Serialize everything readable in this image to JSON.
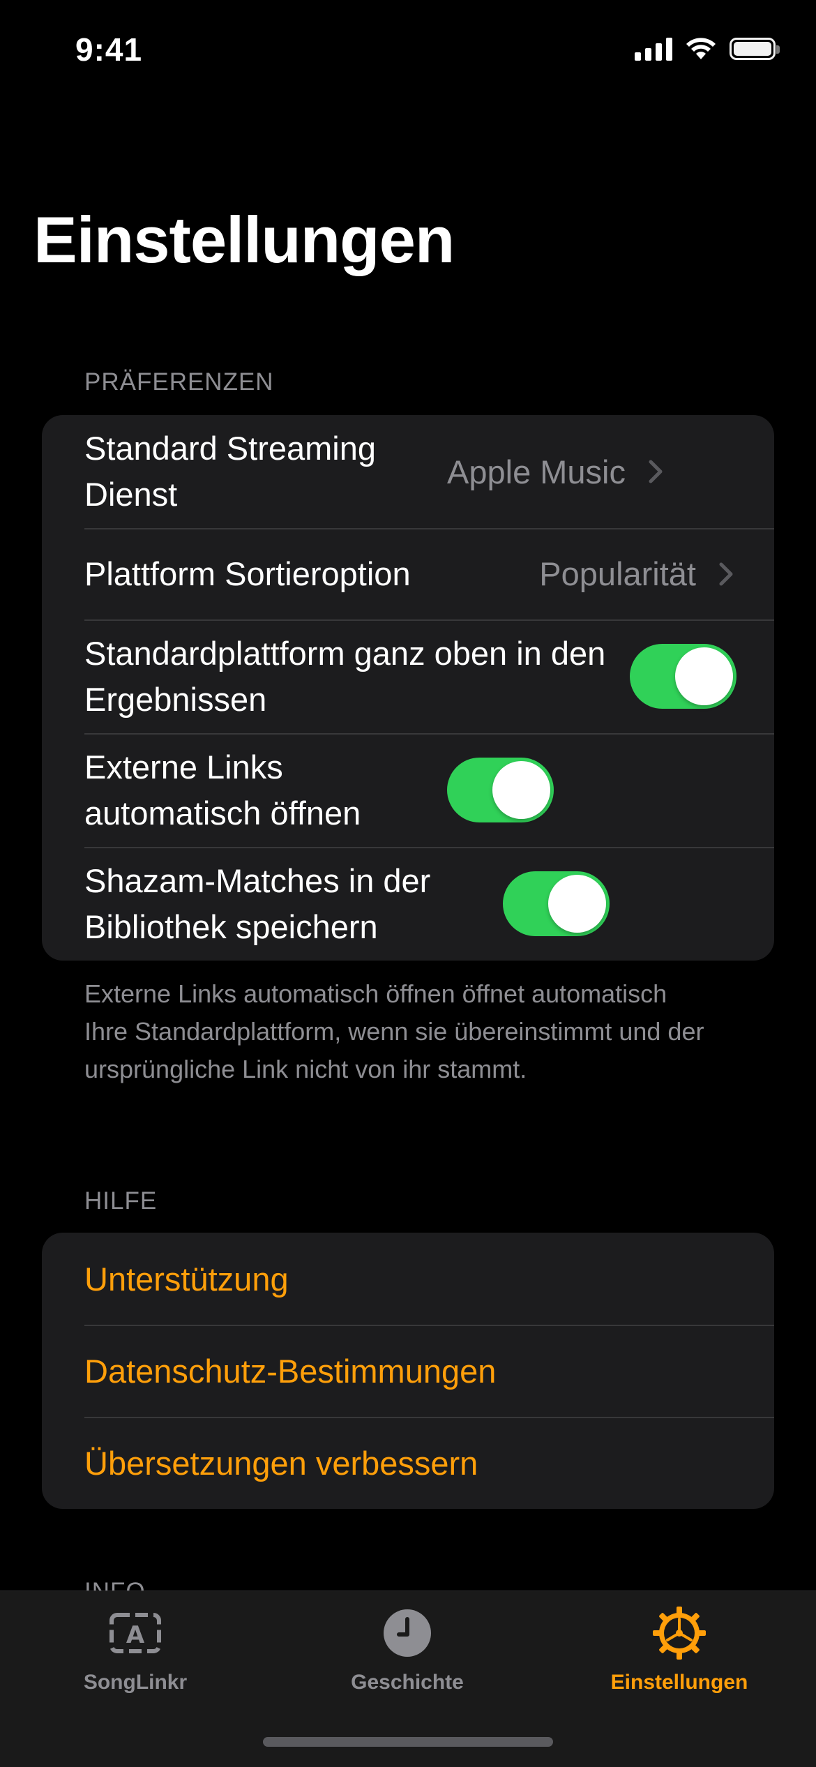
{
  "status_bar": {
    "time": "9:41"
  },
  "page": {
    "title": "Einstellungen"
  },
  "preferences": {
    "header": "PRÄFERENZEN",
    "rows": [
      {
        "label": "Standard Streaming Dienst",
        "value": "Apple Music"
      },
      {
        "label": "Plattform Sortieroption",
        "value": "Popularität"
      },
      {
        "label": "Standardplattform ganz oben in den Ergebnissen",
        "toggle": true
      },
      {
        "label": "Externe Links automatisch öffnen",
        "toggle": true
      },
      {
        "label": "Shazam-Matches in der Bibliothek speichern",
        "toggle": true
      }
    ],
    "footer": "Externe Links automatisch öffnen öffnet automatisch Ihre Standardplattform, wenn sie übereinstimmt und der ursprüngliche Link nicht von ihr stammt."
  },
  "help": {
    "header": "HILFE",
    "links": [
      {
        "label": "Unterstützung"
      },
      {
        "label": "Datenschutz-Bestimmungen"
      },
      {
        "label": "Übersetzungen verbessern"
      }
    ]
  },
  "info": {
    "header": "INFO"
  },
  "tab_bar": {
    "tabs": [
      {
        "label": "SongLinkr",
        "icon": "songlinkr-icon",
        "active": false
      },
      {
        "label": "Geschichte",
        "icon": "clock-icon",
        "active": false
      },
      {
        "label": "Einstellungen",
        "icon": "gear-icon",
        "active": true
      }
    ]
  },
  "colors": {
    "accent": "#ff9f0a",
    "toggle_on": "#30d158",
    "group_bg": "#1c1c1e",
    "secondary_text": "#8e8e93"
  }
}
